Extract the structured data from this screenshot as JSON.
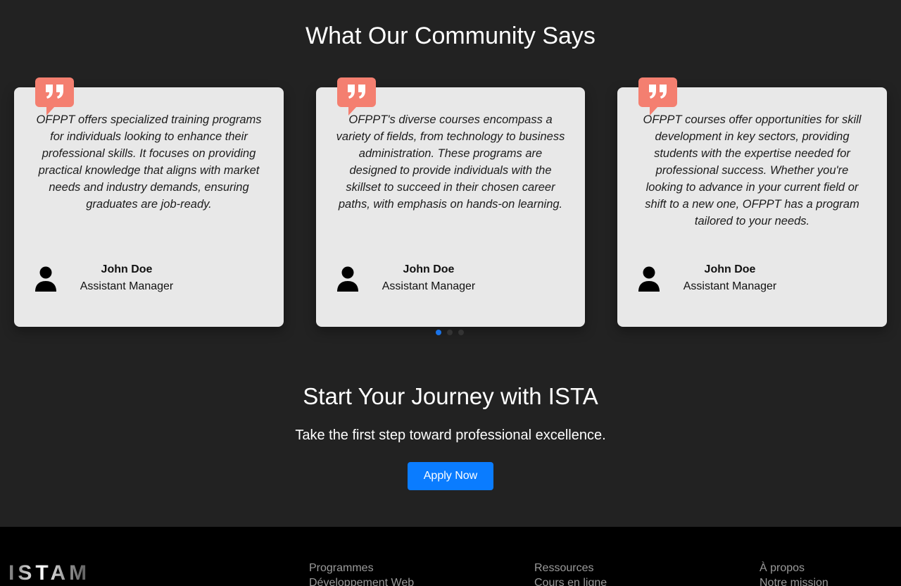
{
  "testimonials": {
    "title": "What Our Community Says",
    "cards": [
      {
        "quote": "OFPPT offers specialized training programs for individuals looking to enhance their professional skills. It focuses on providing practical knowledge that aligns with market needs and industry demands, ensuring graduates are job-ready.",
        "name": "John Doe",
        "role": "Assistant Manager"
      },
      {
        "quote": "OFPPT's diverse courses encompass a variety of fields, from technology to business administration. These programs are designed to provide individuals with the skillset to succeed in their chosen career paths, with emphasis on hands-on learning.",
        "name": "John Doe",
        "role": "Assistant Manager"
      },
      {
        "quote": "OFPPT courses offer opportunities for skill development in key sectors, providing students with the expertise needed for professional success. Whether you're looking to advance in your current field or shift to a new one, OFPPT has a program tailored to your needs.",
        "name": "John Doe",
        "role": "Assistant Manager"
      }
    ],
    "active_slide": 1,
    "total_slides": 3
  },
  "cta": {
    "title": "Start Your Journey with ISTA",
    "subtitle": "Take the first step toward professional excellence.",
    "button_label": "Apply Now"
  },
  "footer": {
    "logo": "ISTAM",
    "columns": [
      {
        "heading": "Programmes",
        "first_link": "Développement Web"
      },
      {
        "heading": "Ressources",
        "first_link": "Cours en ligne"
      },
      {
        "heading": "À propos",
        "first_link": "Notre mission"
      }
    ]
  },
  "colors": {
    "background": "#222222",
    "card": "#e8e8e8",
    "quote_badge": "#f47f70",
    "accent": "#0a7cff",
    "footer": "#000000"
  }
}
